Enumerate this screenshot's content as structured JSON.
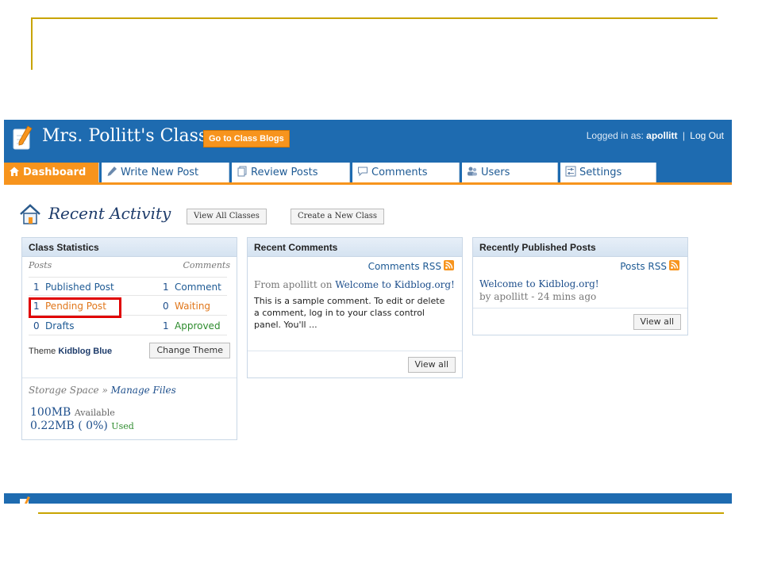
{
  "header": {
    "class_title": "Mrs. Pollitt's Class",
    "go_to_blogs_label": "Go to Class Blogs",
    "logged_in_prefix": "Logged in as:",
    "username": "apollitt",
    "separator": "|",
    "logout_label": "Log Out"
  },
  "tabs": [
    {
      "label": "Dashboard",
      "icon": "house-icon",
      "active": true
    },
    {
      "label": "Write New Post",
      "icon": "pencil-icon"
    },
    {
      "label": "Review Posts",
      "icon": "pages-icon"
    },
    {
      "label": "Comments",
      "icon": "speech-bubble-icon"
    },
    {
      "label": "Users",
      "icon": "users-icon"
    },
    {
      "label": "Settings",
      "icon": "sliders-icon"
    }
  ],
  "page": {
    "title": "Recent Activity",
    "view_all_classes_label": "View All Classes",
    "create_class_label": "Create a New Class"
  },
  "class_statistics": {
    "heading": "Class Statistics",
    "posts_label": "Posts",
    "comments_label": "Comments",
    "rows": [
      {
        "post_count": "1",
        "post_label": "Published Post",
        "comment_count": "1",
        "comment_label": "Comment"
      },
      {
        "post_count": "1",
        "post_label": "Pending Post",
        "comment_count": "0",
        "comment_label": "Waiting"
      },
      {
        "post_count": "0",
        "post_label": "Drafts",
        "comment_count": "1",
        "comment_label": "Approved"
      }
    ],
    "theme_prefix": "Theme",
    "theme_name": "Kidblog Blue",
    "change_theme_label": "Change Theme",
    "storage_label": "Storage Space »",
    "manage_files_label": "Manage Files",
    "available_value": "100MB",
    "available_label": "Available",
    "used_value": "0.22MB ( 0%)",
    "used_label": "Used"
  },
  "recent_comments": {
    "heading": "Recent Comments",
    "rss_label": "Comments RSS",
    "from_prefix": "From apollitt on",
    "post_link": "Welcome to Kidblog.org!",
    "body": "This is a sample comment. To edit or delete a comment, log in to your class control panel. You'll ...",
    "view_all_label": "View all"
  },
  "recent_posts": {
    "heading": "Recently Published Posts",
    "rss_label": "Posts RSS",
    "post_title": "Welcome to Kidblog.org!",
    "post_meta": "by apollitt - 24 mins ago",
    "view_all_label": "View all"
  },
  "colors": {
    "brand_blue": "#1e6bb0",
    "accent_orange": "#f7941d",
    "highlight_red": "#e00000",
    "slide_gold": "#c8a400"
  }
}
